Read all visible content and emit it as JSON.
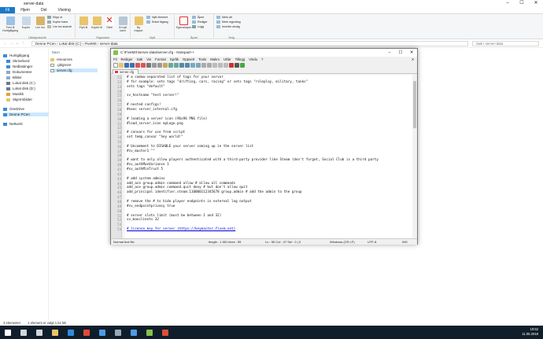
{
  "explorer": {
    "title": "server-data",
    "window_controls": [
      "–",
      "☐",
      "✕"
    ],
    "menu_tabs": [
      "Fil",
      "Hjem",
      "Del",
      "Visning"
    ],
    "ribbon": {
      "groups": [
        "Utklippstavle",
        "Organiser",
        "Nytt",
        "Åpne",
        "Velg"
      ],
      "pin_label": "Fest til Hurtigtilgang",
      "copy_label": "Kopier",
      "paste_label": "Lim inn",
      "cut_label": "Klipp ut",
      "copy_path_label": "Kopier bane",
      "paste_shortcut_label": "Lim inn snarvei",
      "move_to_label": "Flytt til",
      "copy_to_label": "Kopier til",
      "delete_label": "Slett",
      "rename_label": "Gi nytt navn",
      "new_folder_label": "Ny mappe",
      "new_item_label": "Nytt element",
      "easy_access_label": "Enkel tilgang",
      "properties_label": "Egenskaper",
      "open_label": "Åpne",
      "edit_label": "Rediger",
      "history_label": "Logg",
      "select_all_label": "Merk alt",
      "select_none_label": "Merk ingenting",
      "invert_label": "Inverter utvalg"
    },
    "address": "Denne PCen  ›  Lokal disk (C:)  ›  FiveMS  ›  server-data",
    "search_placeholder": "Søk i server-data",
    "nav_items": [
      {
        "label": "Hurtigtilgang",
        "icon": "star-icon",
        "color": "#3b8ad9"
      },
      {
        "label": "Skrivebord",
        "icon": "desktop-icon",
        "color": "#3b8ad9"
      },
      {
        "label": "Nedlastinger",
        "icon": "download-icon",
        "color": "#3b8ad9"
      },
      {
        "label": "Dokumenter",
        "icon": "documents-icon",
        "color": "#8fa9c7"
      },
      {
        "label": "Bilder",
        "icon": "pictures-icon",
        "color": "#8fa9c7"
      },
      {
        "label": "Lokal disk (C:)",
        "icon": "drive-icon",
        "color": "#6b7b8c"
      },
      {
        "label": "Lokal disk (D:)",
        "icon": "drive-icon",
        "color": "#6b7b8c"
      },
      {
        "label": "Musikk",
        "icon": "music-icon",
        "color": "#e2a33d"
      },
      {
        "label": "Skjermbilder",
        "icon": "folder-icon",
        "color": "#e9c46a"
      },
      {
        "label": "OneDrive",
        "icon": "cloud-icon",
        "color": "#3b8ad9"
      },
      {
        "label": "Denne PCen",
        "icon": "pc-icon",
        "color": "#3b8ad9"
      },
      {
        "label": "Nettverk",
        "icon": "network-icon",
        "color": "#3b8ad9"
      }
    ],
    "column_header": "Navn",
    "files": [
      {
        "name": "resources",
        "icon": "folder-icon",
        "color": "#e9c46a"
      },
      {
        "name": ".gitignore",
        "icon": "file-icon",
        "color": "#ffffff"
      },
      {
        "name": "server.cfg",
        "icon": "file-icon",
        "color": "#ffffff"
      }
    ],
    "status_count": "3 elementer",
    "status_selected": "1 element er valgt  1,51 kB"
  },
  "notepad": {
    "title": "C:\\FiveMS\\server-data\\server.cfg - Notepad++",
    "menu": [
      "Fil",
      "Rediger",
      "Søk",
      "Vis",
      "Format",
      "Språk",
      "Oppsett",
      "Tools",
      "Makro",
      "Utfør",
      "Tillegg",
      "Vindu",
      "?"
    ],
    "close_x": "X",
    "tab_label": "server.cfg",
    "lines": [
      {
        "n": "21",
        "text": "# a comma-separated list of tags for your server"
      },
      {
        "n": "22",
        "text": "# for example: sets tags \"drifting, cars, racing\" or sets tags \"roleplay, military, tanks\""
      },
      {
        "n": "23",
        "text": "sets tags \"default\""
      },
      {
        "n": "24",
        "text": ""
      },
      {
        "n": "25",
        "text": "sv_hostname \"test server!\""
      },
      {
        "n": "26",
        "text": ""
      },
      {
        "n": "27",
        "text": "# nested configs!"
      },
      {
        "n": "28",
        "text": "#exec server_internal.cfg"
      },
      {
        "n": "29",
        "text": ""
      },
      {
        "n": "30",
        "text": "# loading a server icon (96x96 PNG file)"
      },
      {
        "n": "31",
        "text": "#load_server_icon myLogo.png"
      },
      {
        "n": "32",
        "text": ""
      },
      {
        "n": "33",
        "text": "# convars for use from script"
      },
      {
        "n": "34",
        "text": "set temp_convar \"hey world!\""
      },
      {
        "n": "35",
        "text": ""
      },
      {
        "n": "36",
        "text": "# Uncomment to DISABLE your server coming up in the server list"
      },
      {
        "n": "37",
        "text": "#sv_master1 \"\""
      },
      {
        "n": "38",
        "text": ""
      },
      {
        "n": "39",
        "text": "# want to only allow players authenticated with a third-party provider like Steam (don't forget, Social Club is a third party"
      },
      {
        "n": "40",
        "text": "#sv_authMaxVariance 1"
      },
      {
        "n": "41",
        "text": "#sv_authMinTrust 5"
      },
      {
        "n": "42",
        "text": ""
      },
      {
        "n": "43",
        "text": "# add system admins"
      },
      {
        "n": "44",
        "text": "add_ace group.admin command allow # allow all commands"
      },
      {
        "n": "45",
        "text": "add_ace group.admin command.quit deny # but don't allow quit"
      },
      {
        "n": "46",
        "text": "add_principal identifier.steam:110000112345678 group.admin # add the admin to the group"
      },
      {
        "n": "47",
        "text": ""
      },
      {
        "n": "48",
        "text": "# remove the # to hide player endpoints in external log output"
      },
      {
        "n": "49",
        "text": "#sv_endpointprivacy true"
      },
      {
        "n": "50",
        "text": ""
      },
      {
        "n": "51",
        "text": "# server slots limit (must be between 1 and 32)"
      },
      {
        "n": "52",
        "text": "sv_maxclients 32"
      },
      {
        "n": "53",
        "text": ""
      },
      {
        "n": "54",
        "text": "# license key for server (https://keymaster.fivem.net)"
      }
    ],
    "status": {
      "type": "Normal text file",
      "length": "length : 1 551    lines : 55",
      "pos": "Ln : 55    Col : 47    Sel : 0 | 0",
      "eol": "Windows (CR LF)",
      "enc": "UTF-8",
      "mode": "INS"
    }
  },
  "taskbar": {
    "time": "19:52",
    "date": "11.05.2018",
    "apps": [
      {
        "icon": "windows-start-icon",
        "color": "#ffffff"
      },
      {
        "icon": "search-icon",
        "color": "#cfd6dd"
      },
      {
        "icon": "task-view-icon",
        "color": "#cfd6dd"
      },
      {
        "icon": "explorer-icon",
        "color": "#e9c46a"
      },
      {
        "icon": "edge-icon",
        "color": "#2f8be0"
      },
      {
        "icon": "chrome-icon",
        "color": "#e3493b"
      },
      {
        "icon": "store-icon",
        "color": "#4c9be8"
      },
      {
        "icon": "steam-icon",
        "color": "#9aa7b4"
      },
      {
        "icon": "mail-icon",
        "color": "#4c9be8"
      },
      {
        "icon": "notepadpp-icon",
        "color": "#86c24a"
      },
      {
        "icon": "game-icon",
        "color": "#d94f3d"
      }
    ]
  }
}
